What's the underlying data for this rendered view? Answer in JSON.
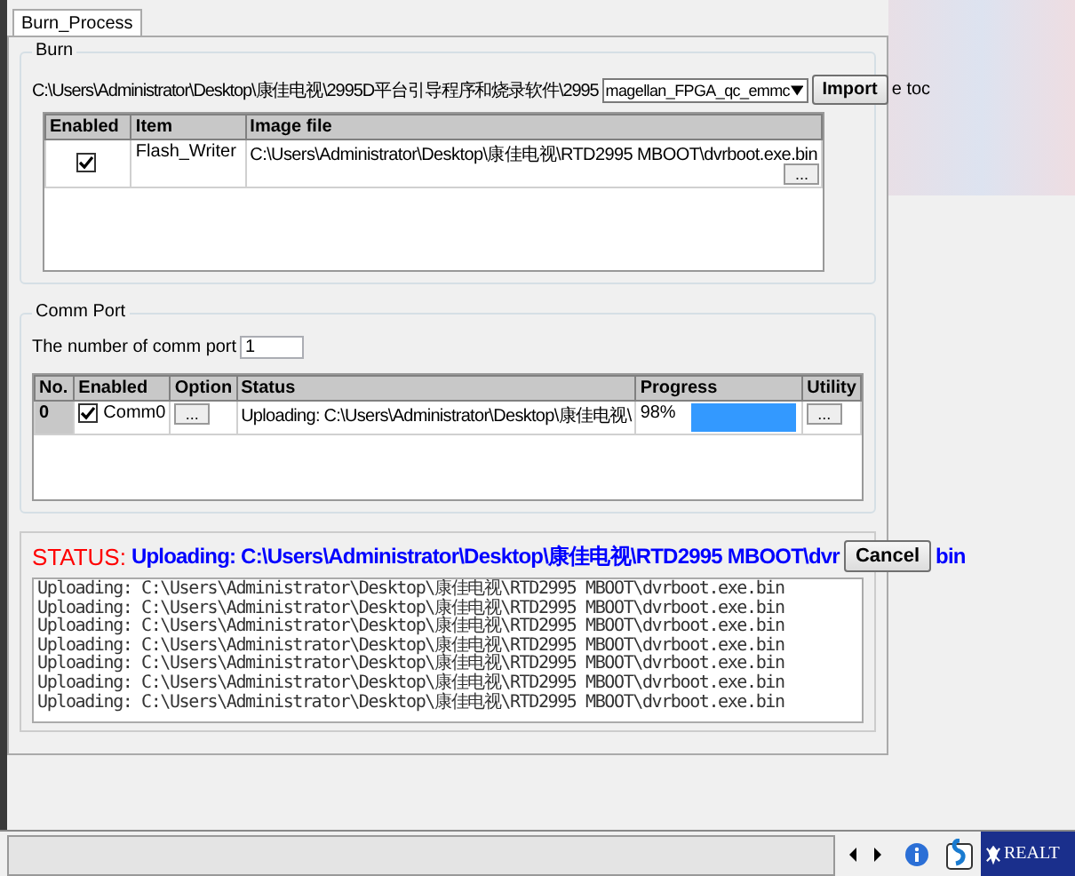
{
  "tabs": [
    {
      "label": "Burn_Process",
      "selected": true
    }
  ],
  "burn": {
    "title": "Burn",
    "path": "C:\\Users\\Administrator\\Desktop\\康佳电视\\2995D平台引导程序和烧录软件\\2995",
    "target": "magellan_FPGA_qc_emmc",
    "import_button": "Import",
    "overflow_text": "e toc",
    "table": {
      "columns": [
        "Enabled",
        "Item",
        "Image file"
      ],
      "rows": [
        {
          "enabled": true,
          "item": "Flash_Writer",
          "image_file": "C:\\Users\\Administrator\\Desktop\\康佳电视\\RTD2995 MBOOT\\dvrboot.exe.bin",
          "browse": "..."
        }
      ]
    }
  },
  "comm_port": {
    "title": "Comm Port",
    "count_label": "The number of comm port",
    "count": "1",
    "table": {
      "columns": [
        "No.",
        "Enabled",
        "Option",
        "Status",
        "Progress",
        "Utility"
      ],
      "rows": [
        {
          "no": "0",
          "enabled": true,
          "name": "Comm0",
          "option": "...",
          "status": "Uploading: C:\\Users\\Administrator\\Desktop\\康佳电视\\",
          "progress": "98%",
          "level": 0.98,
          "utility": "..."
        }
      ]
    }
  },
  "status": {
    "label": "STATUS:",
    "text": "Uploading: C:\\Users\\Administrator\\Desktop\\康佳电视\\RTD2995 MBOOT\\dvr",
    "trailing": "bin",
    "cancel_button": "Cancel",
    "log": [
      "Uploading: C:\\Users\\Administrator\\Desktop\\康佳电视\\RTD2995 MBOOT\\dvrboot.exe.bin",
      "Uploading: C:\\Users\\Administrator\\Desktop\\康佳电视\\RTD2995 MBOOT\\dvrboot.exe.bin",
      "Uploading: C:\\Users\\Administrator\\Desktop\\康佳电视\\RTD2995 MBOOT\\dvrboot.exe.bin",
      "Uploading: C:\\Users\\Administrator\\Desktop\\康佳电视\\RTD2995 MBOOT\\dvrboot.exe.bin",
      "Uploading: C:\\Users\\Administrator\\Desktop\\康佳电视\\RTD2995 MBOOT\\dvrboot.exe.bin",
      "Uploading: C:\\Users\\Administrator\\Desktop\\康佳电视\\RTD2995 MBOOT\\dvrboot.exe.bin",
      "Uploading: C:\\Users\\Administrator\\Desktop\\康佳电视\\RTD2995 MBOOT\\dvrboot.exe.bin"
    ]
  },
  "status_bar": {
    "logo": "REALT"
  }
}
